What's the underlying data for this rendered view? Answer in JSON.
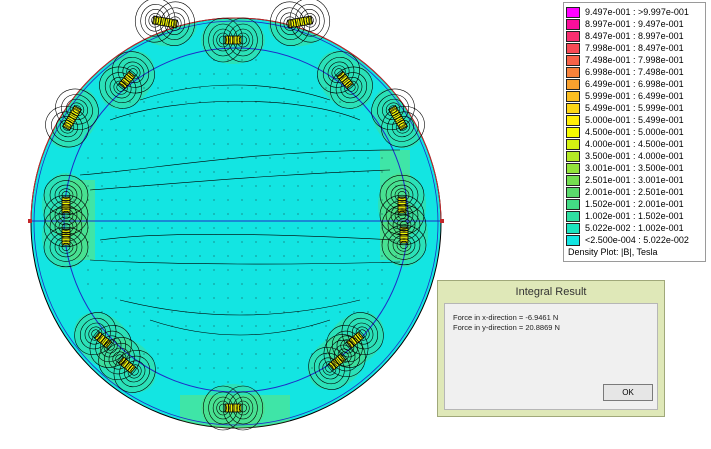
{
  "legend": {
    "entries": [
      {
        "label": "9.497e-001 : >9.997e-001",
        "color": "#ff00ff"
      },
      {
        "label": "8.997e-001 : 9.497e-001",
        "color": "#fb0f9b"
      },
      {
        "label": "8.497e-001 : 8.997e-001",
        "color": "#f82f70"
      },
      {
        "label": "7.998e-001 : 8.497e-001",
        "color": "#f74955"
      },
      {
        "label": "7.498e-001 : 7.998e-001",
        "color": "#f76247"
      },
      {
        "label": "6.998e-001 : 7.498e-001",
        "color": "#f8823a"
      },
      {
        "label": "6.499e-001 : 6.998e-001",
        "color": "#f9a12e"
      },
      {
        "label": "5.999e-001 : 6.499e-001",
        "color": "#fbbe21"
      },
      {
        "label": "5.499e-001 : 5.999e-001",
        "color": "#fdd615"
      },
      {
        "label": "5.000e-001 : 5.499e-001",
        "color": "#ffee08"
      },
      {
        "label": "4.500e-001 : 5.000e-001",
        "color": "#f5fb00"
      },
      {
        "label": "4.000e-001 : 4.500e-001",
        "color": "#d5f212"
      },
      {
        "label": "3.500e-001 : 4.000e-001",
        "color": "#b4ea26"
      },
      {
        "label": "3.001e-001 : 3.500e-001",
        "color": "#93e43a"
      },
      {
        "label": "2.501e-001 : 3.001e-001",
        "color": "#74de50"
      },
      {
        "label": "2.001e-001 : 2.501e-001",
        "color": "#5ad96b"
      },
      {
        "label": "1.502e-001 : 2.001e-001",
        "color": "#43dc85"
      },
      {
        "label": "1.002e-001 : 1.502e-001",
        "color": "#2fdfa1"
      },
      {
        "label": "5.022e-002 : 1.002e-001",
        "color": "#1be3bf"
      },
      {
        "label": "<2.500e-004 : 5.022e-002",
        "color": "#13e5e2"
      }
    ],
    "caption": "Density Plot: |B|, Tesla"
  },
  "plot": {
    "background_color": "#13e5e2",
    "line_color": "#000000",
    "boundary_color": "#1f2bc8",
    "edge_color": "#c4272a"
  },
  "dialog": {
    "title": "Integral Result",
    "line1": "Force in x-direction = -6.9461 N",
    "line2": "Force in y-direction = 20.8869 N",
    "ok_label": "OK"
  }
}
